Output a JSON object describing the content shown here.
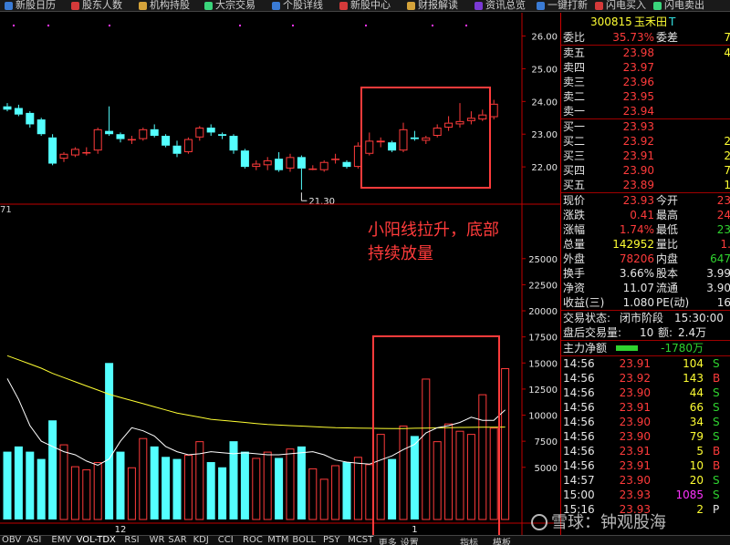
{
  "toolbar": {
    "items": [
      "新股日历",
      "股东人数",
      "机构持股",
      "大宗交易",
      "个股详线",
      "新股中心",
      "财报解读",
      "资讯总览",
      "一键打新",
      "闪电买入",
      "闪电卖出"
    ],
    "colors": [
      "#3a7bd5",
      "#d53a3a",
      "#d5a33a",
      "#3ad57b",
      "#3a7bd5",
      "#d53a3a",
      "#d5a33a",
      "#7b3ad5",
      "#3a7bd5",
      "#d53a3a",
      "#3ad57b"
    ]
  },
  "annotation": {
    "line1": "小阳线拉升，底部",
    "line2": "持续放量"
  },
  "low_price_label": "21.30",
  "vol_indicator_label": "71",
  "bottom_tabs": [
    "OBV",
    "ASI",
    "EMV",
    "VOL-TDX",
    "RSI",
    "WR",
    "SAR",
    "KDJ",
    "CCI",
    "ROC",
    "MTM",
    "BOLL",
    "PSY",
    "MCST",
    "更多",
    "设置"
  ],
  "bottom_selected": "VOL-TDX",
  "bottom_right": [
    "指标",
    "模板"
  ],
  "colors": {
    "up": "#ff3b3b",
    "down": "#54ffff",
    "ma_vol1": "#ffffff",
    "ma_vol2": "#ffff33",
    "highlight_box": "#ff3b3b",
    "axis": "#c00000"
  },
  "chart_data": [
    {
      "type": "candlestick",
      "title": "",
      "ylim": [
        21.0,
        26.6
      ],
      "y_ticks": [
        "26.00",
        "25.00",
        "24.00",
        "23.00",
        "22.00"
      ],
      "y_tick_values": [
        26,
        25,
        24,
        23,
        22
      ],
      "ohlc": [
        [
          23.85,
          23.95,
          23.7,
          23.75
        ],
        [
          23.8,
          23.9,
          23.55,
          23.6
        ],
        [
          23.65,
          23.7,
          23.2,
          23.3
        ],
        [
          23.45,
          23.5,
          22.95,
          23.0
        ],
        [
          22.9,
          23.0,
          22.05,
          22.1
        ],
        [
          22.25,
          22.45,
          22.15,
          22.4
        ],
        [
          22.35,
          22.6,
          22.3,
          22.55
        ],
        [
          22.45,
          22.6,
          22.35,
          22.45
        ],
        [
          22.5,
          23.2,
          22.4,
          23.15
        ],
        [
          23.1,
          23.85,
          22.95,
          23.0
        ],
        [
          23.0,
          23.05,
          22.75,
          22.85
        ],
        [
          22.85,
          22.95,
          22.7,
          22.85
        ],
        [
          22.85,
          23.2,
          22.8,
          23.15
        ],
        [
          23.15,
          23.3,
          22.9,
          22.95
        ],
        [
          22.95,
          23.0,
          22.6,
          22.65
        ],
        [
          22.65,
          22.8,
          22.3,
          22.4
        ],
        [
          22.45,
          22.9,
          22.4,
          22.85
        ],
        [
          22.9,
          23.25,
          22.8,
          23.2
        ],
        [
          23.2,
          23.3,
          22.95,
          23.05
        ],
        [
          23.0,
          23.05,
          22.85,
          22.95
        ],
        [
          22.95,
          23.0,
          22.4,
          22.5
        ],
        [
          22.5,
          22.55,
          21.95,
          22.0
        ],
        [
          22.0,
          22.2,
          21.9,
          22.1
        ],
        [
          22.05,
          22.3,
          21.9,
          22.2
        ],
        [
          22.25,
          22.45,
          21.85,
          21.9
        ],
        [
          21.95,
          22.4,
          21.85,
          22.3
        ],
        [
          22.3,
          22.35,
          21.3,
          21.95
        ],
        [
          21.95,
          22.05,
          21.9,
          21.95
        ],
        [
          21.9,
          22.2,
          21.85,
          22.15
        ],
        [
          22.25,
          22.4,
          22.1,
          22.25
        ],
        [
          22.15,
          22.2,
          21.95,
          22.0
        ],
        [
          22.0,
          22.75,
          21.95,
          22.65
        ],
        [
          22.4,
          23.05,
          22.35,
          22.8
        ],
        [
          22.75,
          22.9,
          22.6,
          22.8
        ],
        [
          22.75,
          22.8,
          22.45,
          22.5
        ],
        [
          22.5,
          23.35,
          22.45,
          23.15
        ],
        [
          22.9,
          23.1,
          22.8,
          22.85
        ],
        [
          22.8,
          22.95,
          22.7,
          22.9
        ],
        [
          22.95,
          23.3,
          22.9,
          23.2
        ],
        [
          23.2,
          23.55,
          23.1,
          23.35
        ],
        [
          23.3,
          23.95,
          23.2,
          23.4
        ],
        [
          23.4,
          23.7,
          23.3,
          23.5
        ],
        [
          23.45,
          23.75,
          23.4,
          23.6
        ],
        [
          23.52,
          24.05,
          23.45,
          23.93
        ]
      ],
      "low_marker": {
        "index": 26,
        "value": 21.3
      },
      "highlight_from_index": 32
    },
    {
      "type": "bar",
      "title": "VOL-TDX",
      "ylim": [
        0,
        29000
      ],
      "y_ticks": [
        "25000",
        "22500",
        "20000",
        "17500",
        "15000",
        "12500",
        "10000",
        "7500",
        "5000"
      ],
      "y_tick_values": [
        25000,
        22500,
        20000,
        17500,
        15000,
        12500,
        10000,
        7500,
        5000
      ],
      "x_labels": [
        {
          "index": 10,
          "label": "12"
        },
        {
          "index": 36,
          "label": "1"
        }
      ],
      "volumes": [
        6500,
        7000,
        6500,
        5800,
        9500,
        7200,
        5100,
        4800,
        5500,
        15000,
        6500,
        5000,
        7800,
        7000,
        6000,
        5800,
        6200,
        7500,
        5500,
        5000,
        7500,
        6500,
        5900,
        6500,
        5900,
        6800,
        7000,
        4900,
        3900,
        5200,
        5500,
        6000,
        5300,
        8200,
        5800,
        9000,
        8000,
        13500,
        7500,
        9200,
        8500,
        8200,
        12000,
        8800,
        14500
      ],
      "ma1": [
        13500,
        11500,
        9000,
        7500,
        7000,
        6500,
        6200,
        5600,
        5200,
        5800,
        7500,
        8800,
        8500,
        8000,
        7000,
        6500,
        6200,
        6300,
        6500,
        6400,
        6300,
        6400,
        6300,
        6200,
        6200,
        6300,
        6400,
        6500,
        6200,
        5700,
        5500,
        5400,
        5300,
        5700,
        6100,
        6700,
        7200,
        8300,
        8800,
        9000,
        9300,
        9800,
        9500,
        9500,
        10500
      ],
      "ma2": [
        15700,
        15300,
        14900,
        14500,
        14000,
        13600,
        13200,
        12800,
        12400,
        12000,
        11700,
        11400,
        11100,
        10800,
        10500,
        10200,
        10000,
        9800,
        9600,
        9500,
        9400,
        9300,
        9200,
        9100,
        9050,
        9000,
        8950,
        8900,
        8850,
        8800,
        8780,
        8760,
        8740,
        8730,
        8720,
        8720,
        8740,
        8760,
        8780,
        8800,
        8820,
        8830,
        8840,
        8850,
        8860
      ]
    }
  ],
  "quote": {
    "code": "300815",
    "name": "玉禾田",
    "mark": "T",
    "weibi_label": "委比",
    "weibi_value": "35.73%",
    "weicha_label": "委差",
    "weicha_value": "7",
    "asks": [
      {
        "label": "卖五",
        "price": "23.98",
        "vol": "4"
      },
      {
        "label": "卖四",
        "price": "23.97",
        "vol": ""
      },
      {
        "label": "卖三",
        "price": "23.96",
        "vol": ""
      },
      {
        "label": "卖二",
        "price": "23.95",
        "vol": ""
      },
      {
        "label": "卖一",
        "price": "23.94",
        "vol": ""
      }
    ],
    "bids": [
      {
        "label": "买一",
        "price": "23.93",
        "vol": ""
      },
      {
        "label": "买二",
        "price": "23.92",
        "vol": "2"
      },
      {
        "label": "买三",
        "price": "23.91",
        "vol": "2"
      },
      {
        "label": "买四",
        "price": "23.90",
        "vol": "7"
      },
      {
        "label": "买五",
        "price": "23.89",
        "vol": "1"
      }
    ],
    "stats": [
      {
        "l1": "现价",
        "v1": "23.93",
        "c1": "red",
        "l2": "今开",
        "v2": "23",
        "c2": "red"
      },
      {
        "l1": "涨跌",
        "v1": "0.41",
        "c1": "red",
        "l2": "最高",
        "v2": "24",
        "c2": "red"
      },
      {
        "l1": "涨幅",
        "v1": "1.74%",
        "c1": "red",
        "l2": "最低",
        "v2": "23",
        "c2": "green"
      },
      {
        "l1": "总量",
        "v1": "142952",
        "c1": "yellow",
        "l2": "量比",
        "v2": "1.",
        "c2": "red"
      },
      {
        "l1": "外盘",
        "v1": "78206",
        "c1": "red",
        "l2": "内盘",
        "v2": "647",
        "c2": "green"
      },
      {
        "l1": "换手",
        "v1": "3.66%",
        "c1": "white",
        "l2": "股本",
        "v2": "3.99",
        "c2": "white"
      },
      {
        "l1": "净资",
        "v1": "11.07",
        "c1": "white",
        "l2": "流通",
        "v2": "3.90",
        "c2": "white"
      },
      {
        "l1": "收益(三)",
        "v1": "1.080",
        "c1": "white",
        "l2": "PE(动)",
        "v2": "16",
        "c2": "white"
      }
    ],
    "trade_status_label": "交易状态:",
    "trade_status": "闭市阶段",
    "trade_time": "15:30:00",
    "after_label": "盘后交易量:",
    "after_vol": "10",
    "after_amt_label": "额:",
    "after_amt": "2.4万",
    "main_flow_label": "主力净额",
    "main_flow_value": "-1780万",
    "ticks": [
      {
        "time": "14:56",
        "price": "23.91",
        "pc": "red",
        "vol": "104",
        "vc": "yellow",
        "side": "S",
        "sc": "green"
      },
      {
        "time": "14:56",
        "price": "23.92",
        "pc": "red",
        "vol": "143",
        "vc": "yellow",
        "side": "B",
        "sc": "red"
      },
      {
        "time": "14:56",
        "price": "23.90",
        "pc": "red",
        "vol": "44",
        "vc": "yellow",
        "side": "S",
        "sc": "green"
      },
      {
        "time": "14:56",
        "price": "23.91",
        "pc": "red",
        "vol": "66",
        "vc": "yellow",
        "side": "S",
        "sc": "green"
      },
      {
        "time": "14:56",
        "price": "23.90",
        "pc": "red",
        "vol": "34",
        "vc": "yellow",
        "side": "S",
        "sc": "green"
      },
      {
        "time": "14:56",
        "price": "23.90",
        "pc": "red",
        "vol": "79",
        "vc": "yellow",
        "side": "S",
        "sc": "green"
      },
      {
        "time": "14:56",
        "price": "23.91",
        "pc": "red",
        "vol": "5",
        "vc": "yellow",
        "side": "B",
        "sc": "red"
      },
      {
        "time": "14:56",
        "price": "23.91",
        "pc": "red",
        "vol": "10",
        "vc": "yellow",
        "side": "B",
        "sc": "red"
      },
      {
        "time": "14:57",
        "price": "23.90",
        "pc": "red",
        "vol": "20",
        "vc": "yellow",
        "side": "S",
        "sc": "green"
      },
      {
        "time": "15:00",
        "price": "23.93",
        "pc": "red",
        "vol": "1085",
        "vc": "magenta",
        "side": "S",
        "sc": "green"
      },
      {
        "time": "15:16",
        "price": "23.93",
        "pc": "red",
        "vol": "2",
        "vc": "yellow",
        "side": "P",
        "sc": "white"
      }
    ]
  },
  "watermark": "雪球：钟观股海"
}
